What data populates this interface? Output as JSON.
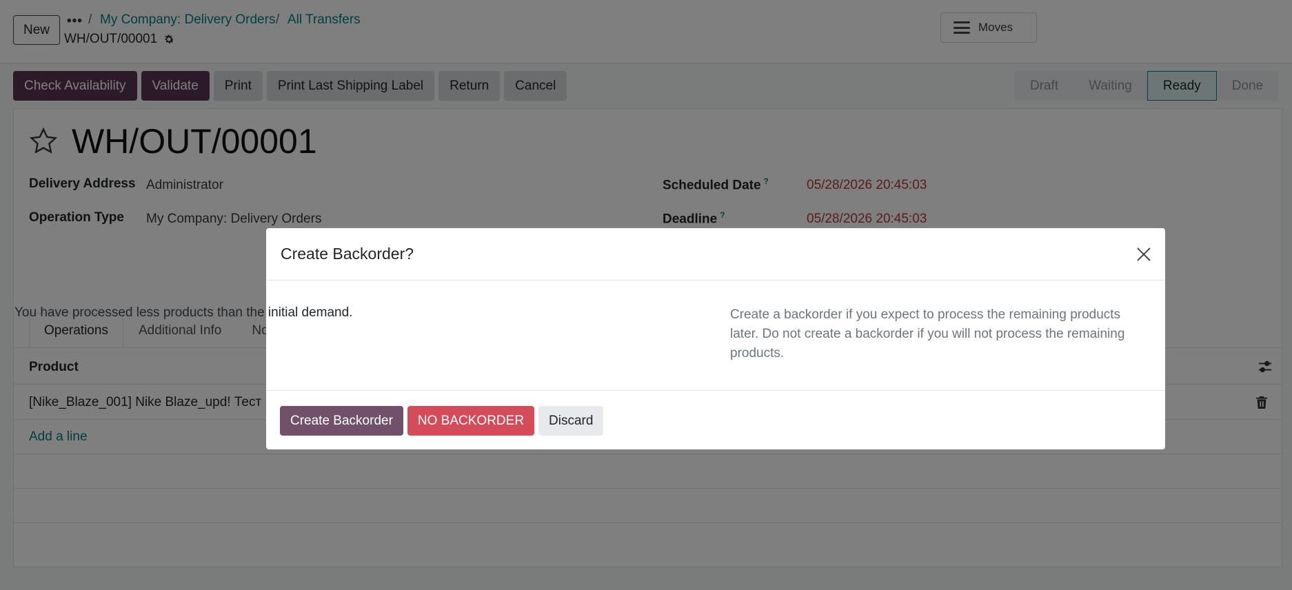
{
  "control_panel": {
    "new_label": "New",
    "dots": "•••",
    "breadcrumb": [
      "My Company: Delivery Orders",
      "All Transfers"
    ],
    "breadcrumb_sep": "/",
    "record_name": "WH/OUT/00001",
    "moves_label": "Moves"
  },
  "actions": {
    "check_availability": "Check Availability",
    "validate": "Validate",
    "print": "Print",
    "print_last_shipping_label": "Print Last Shipping Label",
    "return": "Return",
    "cancel": "Cancel"
  },
  "statusbar": {
    "stages": [
      "Draft",
      "Waiting",
      "Ready",
      "Done"
    ],
    "current": "Ready"
  },
  "form": {
    "title": "WH/OUT/00001",
    "delivery_address_label": "Delivery Address",
    "delivery_address": "Administrator",
    "operation_type_label": "Operation Type",
    "operation_type": "My Company: Delivery Orders",
    "scheduled_date_label": "Scheduled Date",
    "scheduled_date": "05/28/2026 20:45:03",
    "deadline_label": "Deadline",
    "deadline": "05/28/2026 20:45:03",
    "help_mark": "?"
  },
  "tabs": [
    "Operations",
    "Additional Info",
    "No"
  ],
  "table": {
    "product_header": "Product",
    "rows": [
      "[Nike_Blaze_001] Nike Blaze_upd! Тест"
    ],
    "add_line": "Add a line"
  },
  "dialog": {
    "title": "Create Backorder?",
    "message_left": "You have processed less products than the initial demand.",
    "message_right": "Create a backorder if you expect to process the remaining products later. Do not create a backorder if you will not process the remaining products.",
    "create_backorder": "Create Backorder",
    "no_backorder": "NO BACKORDER",
    "discard": "Discard"
  },
  "colors": {
    "primary": "#5b3550",
    "link": "#017e84",
    "danger": "#d44c59",
    "date_red": "#b03a3a"
  }
}
